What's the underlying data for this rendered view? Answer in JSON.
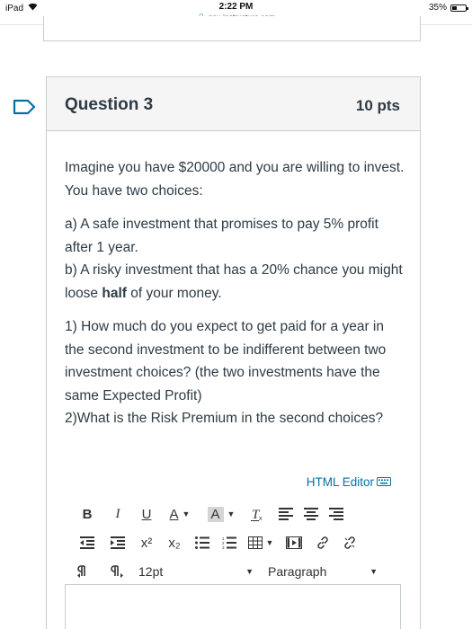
{
  "status_bar": {
    "device": "iPad",
    "time": "2:22 PM",
    "url": "psu.instructure.com",
    "battery": "35%",
    "battery_level": 0.35
  },
  "question": {
    "title": "Question 3",
    "points": "10 pts",
    "p1": "Imagine you have $20000 and you are willing to invest. You have two choices:",
    "a_line": "a) A safe investment that promises to pay 5% profit after 1 year.",
    "b_line_before": "b) A risky investment that has a 20% chance you might loose ",
    "b_line_bold": "half",
    "b_line_after": " of your money.",
    "q1": "1) How much do you expect to get paid for a year in the second investment to be indifferent between two investment choices? (the two investments have the same Expected Profit)",
    "q2": "2)What is the Risk Premium in the second choices?"
  },
  "editor": {
    "html_editor_label": "HTML Editor",
    "bold": "B",
    "italic": "I",
    "underline": "U",
    "font_color": "A",
    "bg_color": "A",
    "font_size": "12pt",
    "paragraph": "Paragraph",
    "superscript": "x²",
    "subscript": "x₂"
  },
  "colors": {
    "flag": "#0770a3",
    "link": "#0770a3",
    "header_bg": "#f5f5f5",
    "border": "#c7cdd1",
    "text": "#2d3b45"
  }
}
